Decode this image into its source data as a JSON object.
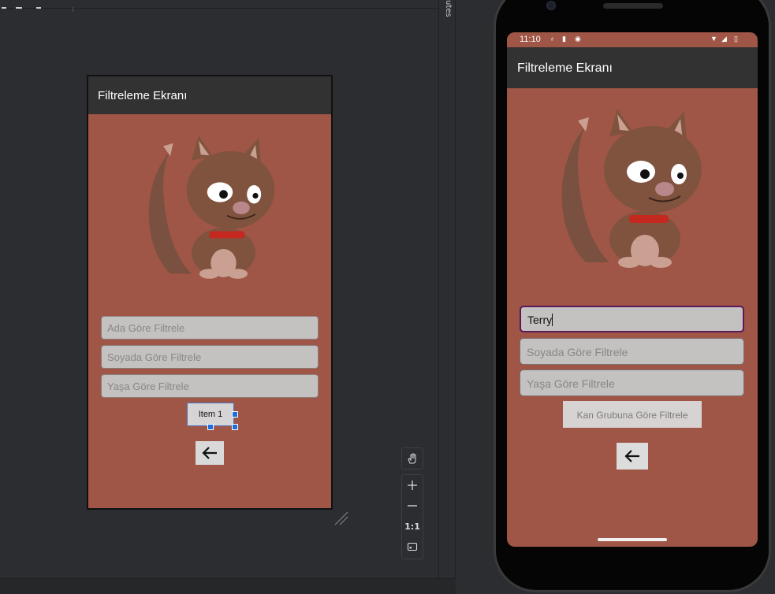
{
  "side_tab": {
    "label": "utes"
  },
  "design_preview": {
    "title": "Filtreleme Ekranı",
    "fields": [
      {
        "placeholder": "Ada Göre Filtrele"
      },
      {
        "placeholder": "Soyada Göre Filtrele"
      },
      {
        "placeholder": "Yaşa Göre Filtrele"
      }
    ],
    "spinner_label": "Item 1"
  },
  "zoom_toolbar": {
    "pan_icon": "hand-icon",
    "zoom_in": "+",
    "zoom_out": "—",
    "actual_size": "1:1",
    "fit_icon": "fit-screen-icon"
  },
  "emulator": {
    "status_time": "11:10",
    "title": "Filtreleme Ekranı",
    "fields": [
      {
        "value": "Terry"
      },
      {
        "placeholder": "Soyada Göre Filtrele"
      },
      {
        "placeholder": "Yaşa Göre Filtrele"
      }
    ],
    "button_label": "Kan Grubuna Göre Filtrele"
  },
  "colors": {
    "screen_background": "#a05646",
    "appbar": "#323232",
    "field_background": "#c4c1c1",
    "focused_field_border": "#5a1a5a",
    "selection": "#1e6de0"
  }
}
